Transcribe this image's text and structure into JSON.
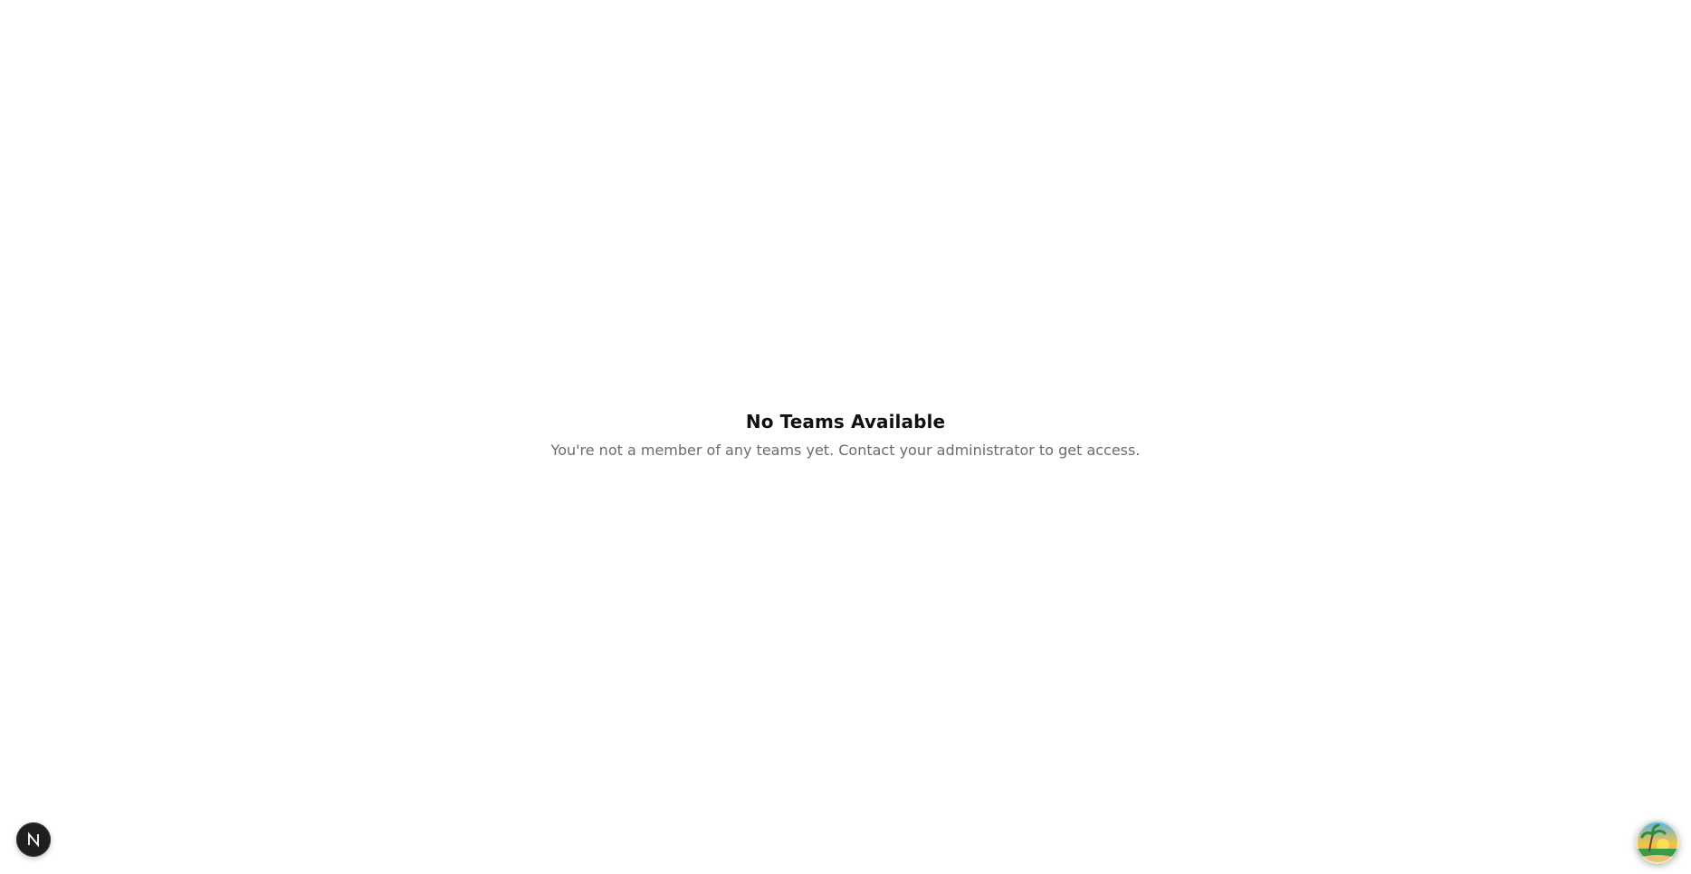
{
  "empty_state": {
    "title": "No Teams Available",
    "message": "You're not a member of any teams yet. Contact your administrator to get access."
  },
  "dev_badge": {
    "icon": "next-logo-icon",
    "color": "#1f1f1f"
  },
  "helper_widget": {
    "icon": "beach-sunset-icon"
  }
}
